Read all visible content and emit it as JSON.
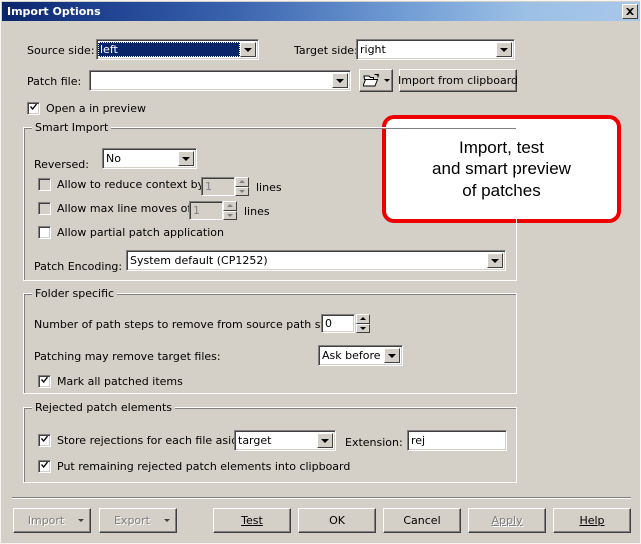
{
  "window": {
    "title": "Import Options",
    "close_icon": "close-icon",
    "close_glyph": "✕"
  },
  "colors": {
    "titlebar_start": "#0a246a",
    "titlebar_end": "#a8c8ea",
    "dialog_face": "#d4d0c8",
    "callout_border": "#ee0000",
    "selection": "#0a246a"
  },
  "top": {
    "source_side_label": "Source side:",
    "source_side_value": "left",
    "target_side_label": "Target side:",
    "target_side_value": "right",
    "patch_file_label": "Patch file:",
    "patch_file_value": "",
    "open_folder_icon": "open-folder-icon",
    "import_from_clipboard_label": "Import from clipboard",
    "open_in_preview_label": "Open a in preview",
    "open_in_preview_checked": true
  },
  "callout": {
    "line1": "Import, test",
    "line2": "and smart preview",
    "line3": "of patches"
  },
  "smart_import": {
    "title": "Smart Import",
    "reversed_label": "Reversed:",
    "reversed_value": "No",
    "reduce_context_label": "Allow to reduce context by",
    "reduce_context_checked": false,
    "reduce_context_value": "1",
    "reduce_context_units": "lines",
    "max_line_moves_label": "Allow max line moves of",
    "max_line_moves_checked": false,
    "max_line_moves_value": "1",
    "max_line_moves_units": "lines",
    "partial_patch_label": "Allow partial patch application",
    "partial_patch_checked": false,
    "patch_encoding_label": "Patch Encoding:",
    "patch_encoding_value": "System default (CP1252)"
  },
  "folder_specific": {
    "title": "Folder specific",
    "path_steps_label": "Number of path steps to remove from source path start:",
    "path_steps_value": "0",
    "remove_target_label": "Patching may remove target files:",
    "remove_target_value": "Ask before",
    "mark_patched_label": "Mark all patched items",
    "mark_patched_checked": true
  },
  "rejected": {
    "title": "Rejected patch elements",
    "store_rejections_label": "Store rejections for each file aside:",
    "store_rejections_checked": true,
    "store_rejections_value": "target",
    "extension_label": "Extension:",
    "extension_value": "rej",
    "put_remaining_label": "Put remaining rejected patch elements into clipboard",
    "put_remaining_checked": true
  },
  "buttons": {
    "import_label": "Import",
    "import_enabled": false,
    "export_label": "Export",
    "export_enabled": false,
    "test_label": "Test",
    "ok_label": "OK",
    "cancel_label": "Cancel",
    "apply_label": "Apply",
    "apply_enabled": false,
    "help_label": "Help"
  }
}
